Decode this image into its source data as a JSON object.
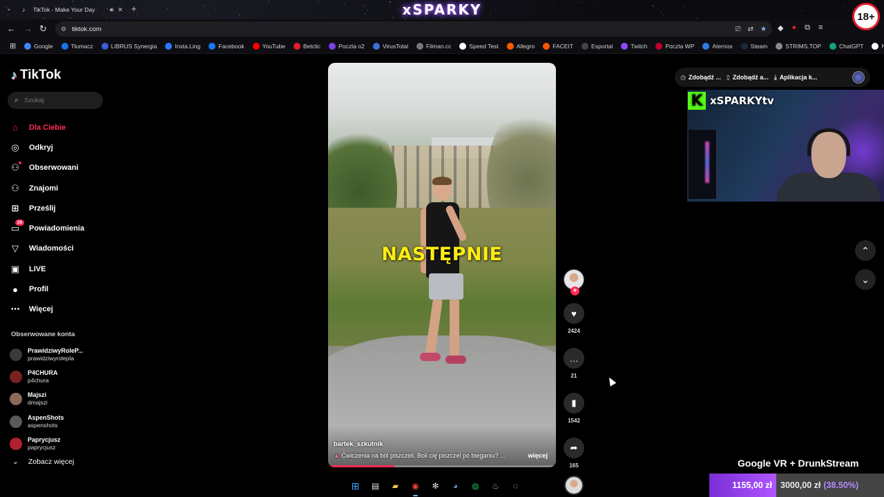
{
  "browser": {
    "tab_title": "TikTok - Make Your Day",
    "brand_overlay": "xSPARKY",
    "age_badge": "18+",
    "url": "tiktok.com",
    "bookmarks": [
      "Google",
      "Tłumacz",
      "LIBRUS Synergia",
      "Insta.Ling",
      "Facebook",
      "YouTube",
      "Betclic",
      "Poczta o2",
      "VirusTotal",
      "Filman.cc",
      "Speed Test",
      "Allegro",
      "FACEIT",
      "Esportal",
      "Twitch",
      "Poczta WP",
      "Aternos",
      "Steam",
      "STRIMS.TOP",
      "ChatGPT",
      "Nike"
    ],
    "bookmark_colors": [
      "#4285f4",
      "#1a73e8",
      "#3a5dd9",
      "#2e78ff",
      "#1877f2",
      "#ff0000",
      "#e11d2a",
      "#7b3fe4",
      "#3c6fd8",
      "#777777",
      "#ffffff",
      "#ff5a00",
      "#ff5500",
      "#444444",
      "#9146ff",
      "#c0002a",
      "#2c7be5",
      "#1b2838",
      "#8a8a8a",
      "#10a37f",
      "#ffffff"
    ]
  },
  "tiktok": {
    "logo": "TikTok",
    "search_placeholder": "Szukaj",
    "nav": [
      {
        "label": "Dla Ciebie",
        "icon": "home-icon",
        "glyph": "⌂"
      },
      {
        "label": "Odkryj",
        "icon": "compass-icon",
        "glyph": "◎"
      },
      {
        "label": "Obserwowani",
        "icon": "following-icon",
        "glyph": "⚇"
      },
      {
        "label": "Znajomi",
        "icon": "friends-icon",
        "glyph": "⚇"
      },
      {
        "label": "Prześlij",
        "icon": "upload-icon",
        "glyph": "⊞"
      },
      {
        "label": "Powiadomienia",
        "icon": "inbox-icon",
        "glyph": "▭"
      },
      {
        "label": "Wiadomości",
        "icon": "send-icon",
        "glyph": "▽"
      },
      {
        "label": "LIVE",
        "icon": "live-icon",
        "glyph": "▣"
      },
      {
        "label": "Profil",
        "icon": "profile-icon",
        "glyph": "●"
      },
      {
        "label": "Więcej",
        "icon": "more-icon",
        "glyph": "⋯"
      }
    ],
    "notifications_count": "26",
    "followed_title": "Obserwowane konta",
    "followed": [
      {
        "display": "PrawidziwyRoleP...",
        "user": "prawidziwyrolepla",
        "color": "#3a3a3a"
      },
      {
        "display": "P4CHURA",
        "user": "p4chura",
        "color": "#7a2020"
      },
      {
        "display": "Majszi",
        "user": "dmajszi",
        "color": "#8a6a5a"
      },
      {
        "display": "AspenShots",
        "user": "aspenshots",
        "color": "#5a5a5a"
      },
      {
        "display": "Paprycjusz",
        "user": "paprycjusz",
        "color": "#b02030"
      }
    ],
    "see_more": "Zobacz więcej",
    "video": {
      "caption": "NASTĘPNIE",
      "author": "bartek_szkutnik",
      "description": "Ćwiczenia na ból piszczeli. Boli cię piszczel po bieganiu? ...",
      "more": "więcej",
      "progress": 0.29,
      "likes": "2424",
      "comments": "21",
      "saves": "1542",
      "shares": "165"
    },
    "app_buttons": [
      "Zdobądź ...",
      "Zdobądź a...",
      "Aplikacja k..."
    ]
  },
  "stream": {
    "channel": "xSPARKYtv",
    "title": "Google VR + DrunkStream",
    "current": "1155,00 zł",
    "goal": "3000,00 zł",
    "percent": "(38.50%)"
  }
}
